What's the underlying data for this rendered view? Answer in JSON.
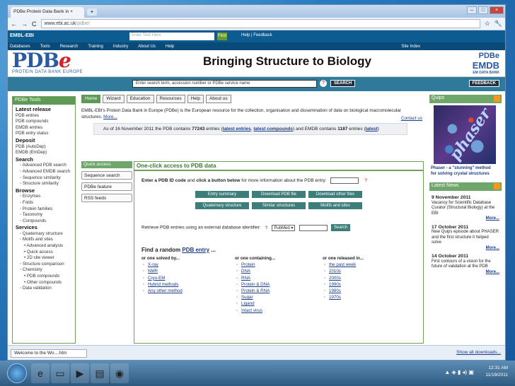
{
  "browser": {
    "tab_title": "PDBe Protein Data Bank in",
    "tab_close": "×",
    "new_tab": "+",
    "url_host": "www.ebi.ac.uk",
    "url_path": "/pdbe/",
    "back": "←",
    "forward": "→",
    "reload": "C",
    "home": "⌂",
    "star": "☆",
    "wrench": "🔧"
  },
  "ebi": {
    "logo": "EMBL-EBI",
    "search_placeholder": "Enter Text Here",
    "find": "Find",
    "links": "Help | Feedback",
    "nav": [
      "Databases",
      "Tools",
      "Research",
      "Training",
      "Industry",
      "About Us",
      "Help"
    ],
    "site_index": "Site Index"
  },
  "banner": {
    "logo_main": "PDB",
    "logo_e": "e",
    "logo_sub": "PROTEIN DATA BANK EUROPE",
    "headline": "Bringing Structure to Biology",
    "emdb_top": "PDBe",
    "emdb_main": "EMDB",
    "emdb_sub": "EM DATA BANK"
  },
  "search": {
    "placeholder": "Enter search term, accession number or PDBe service name",
    "q": "?",
    "button": "SEARCH",
    "feedback": "FEEDBACK"
  },
  "left": {
    "header": "PDBe Tools",
    "sections": [
      {
        "title": "Latest release",
        "items": [
          "PDB entries",
          "PDB compounds",
          "EMDB entries",
          "PDB entry status"
        ]
      },
      {
        "title": "Deposit",
        "items": [
          "PDB (AutoDep)",
          "EMDB (EmDep)"
        ]
      },
      {
        "title": "Search",
        "items": [
          "◦ Advanced PDB search",
          "◦ Advanced EMDB search",
          "◦ Sequence similarity",
          "◦ Structure similarity"
        ]
      },
      {
        "title": "Browse",
        "items": [
          "◦ Enzymes",
          "◦ Folds",
          "◦ Protein families",
          "◦ Taxonomy",
          "◦ Compounds"
        ]
      }
    ],
    "services_title": "Services",
    "services": [
      "◦ Quaternary structure",
      "◦ Motifs and sites",
      "• Advanced analysis",
      "• Quick access",
      "• 2D site viewer",
      "◦ Structure comparison",
      "◦ Chemistry",
      "• PDB compounds",
      "• Other compounds",
      "◦ Data validation"
    ]
  },
  "tabs": [
    "Home",
    "Wizard",
    "Education",
    "Resources",
    "Help",
    "About us"
  ],
  "intro": {
    "t1": "EMBL-EBI's Protein Data Bank in Europe (PDBe) is the European resource for the collection, organisation and dissemination of data on biological macromolecular structures.",
    "more": "More...",
    "contact": "Contact us"
  },
  "stats": {
    "p1": "As of 16 November 2011 the PDB contains",
    "pdb_count": "77243",
    "p2": "entries (",
    "latest_entries": "latest entries",
    "comma": ",",
    "latest_compounds": "latest compounds",
    "p3": ") and EMDB contains",
    "emdb_count": "1187",
    "p4": "entries (",
    "latest": "latest",
    "p5": ")"
  },
  "quick": {
    "header": "Quick access",
    "buttons": [
      "Sequence search",
      "PDBe feature",
      "RSS feeds"
    ]
  },
  "oneclick": {
    "header": "One-click access to PDB data",
    "prompt_a": "Enter a PDB ID code",
    "prompt_b": "and",
    "prompt_c": "click a button below",
    "prompt_d": "for more information about the PDB entry:",
    "buttons": [
      "Entry summary",
      "Download PDB file",
      "Download other files",
      "Quaternary structure",
      "Similar structures",
      "Motifs and sites"
    ],
    "retrieve": "Retrieve PDB entries using an external database identifier:",
    "db": "PubMed",
    "search": "Search"
  },
  "random": {
    "title_a": "Find a random",
    "title_link": "PDB entry",
    "title_b": "...",
    "col1_title": "or one solved by...",
    "col1": [
      "X-ray",
      "NMR",
      "Cryo-EM",
      "Hybrid methods",
      "Any other method"
    ],
    "col2_title": "or one containing...",
    "col2": [
      "Protein",
      "DNA",
      "RNA",
      "Protein & DNA",
      "Protein & RNA",
      "Sugar",
      "Ligand",
      "Intact virus"
    ],
    "col3_title": "or one released in...",
    "col3": [
      "the past week",
      "2010s",
      "2000s",
      "1990s",
      "1980s",
      "1970s"
    ]
  },
  "quips": {
    "header": "Quips",
    "image_text": "phaser",
    "caption": "Phaser - a \"stunning\" method for solving crystal structures"
  },
  "news": {
    "header": "Latest News",
    "items": [
      {
        "date": "9 November 2011",
        "text": "Vacancy for Scientific Database Curator (Structural Biology) at the EBI",
        "more": "More..."
      },
      {
        "date": "17 October 2011",
        "text": "New Quips episode about PHASER and the first structure it helped solve",
        "more": "More..."
      },
      {
        "date": "14 October 2011",
        "text": "First contours of a vision for the future of validation at the PDB",
        "more": "More..."
      }
    ]
  },
  "status": {
    "download": "Welcome to the Wo....htm",
    "show_all": "Show all downloads..."
  },
  "taskbar": {
    "time": "12:31 AM",
    "date": "11/19/2011"
  }
}
